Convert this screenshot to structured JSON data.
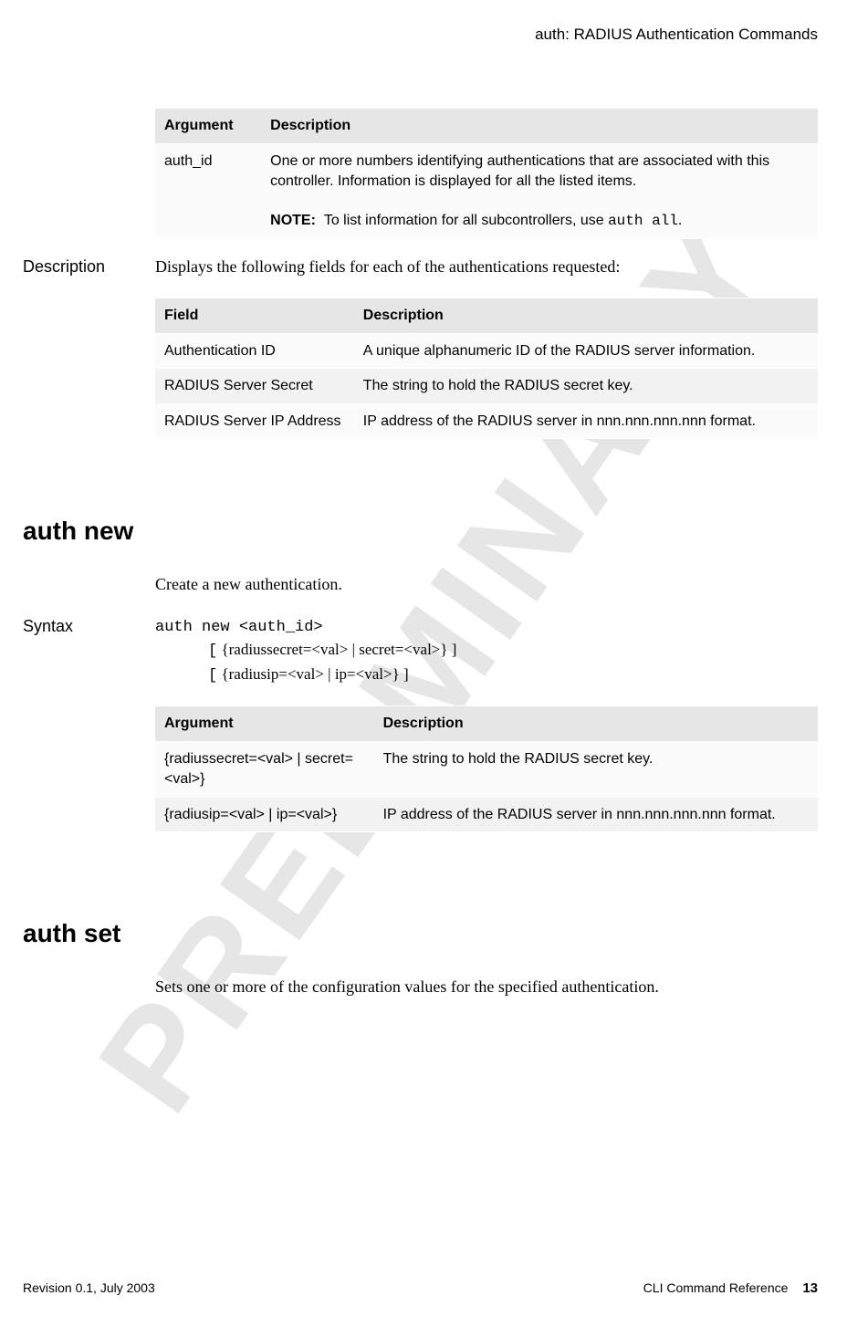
{
  "watermark": "PRELIMINARY",
  "header": {
    "right": "auth: RADIUS Authentication Commands"
  },
  "table1": {
    "head_arg": "Argument",
    "head_desc": "Description",
    "row1_arg": "auth_id",
    "row1_desc_p1": "One or more numbers identifying authentications that are associated with this controller. Information is displayed for all the listed items.",
    "row1_note_label": "NOTE:",
    "row1_note_text": "To list information for all subcontrollers, use ",
    "row1_note_code": "auth all",
    "row1_note_tail": "."
  },
  "description": {
    "label": "Description",
    "text": "Displays the following fields for each of the authentications requested:"
  },
  "table2": {
    "head_field": "Field",
    "head_desc": "Description",
    "r1_f": "Authentication ID",
    "r1_d": "A unique alphanumeric ID of the RADIUS server information.",
    "r2_f": "RADIUS Server Secret",
    "r2_d": "The string to hold the RADIUS secret key.",
    "r3_f": "RADIUS Server IP Address",
    "r3_d": "IP address of the RADIUS server in nnn.nnn.nnn.nnn format."
  },
  "auth_new": {
    "heading": "auth new",
    "intro": "Create a new authentication.",
    "syntax_label": "Syntax",
    "syntax_line1": "auth new <auth_id>",
    "syntax_line2_pre": "[",
    "syntax_line2_body": " {radiussecret=<val> | secret=<val>} ]",
    "syntax_line3_pre": "[",
    "syntax_line3_body": " {radiusip=<val> | ip=<val>} ]"
  },
  "table3": {
    "head_arg": "Argument",
    "head_desc": "Description",
    "r1_a": " {radiussecret=<val> | secret=<val>}",
    "r1_d": " The string to hold the RADIUS secret key.",
    "r2_a": " {radiusip=<val> | ip=<val>}",
    "r2_d": " IP address of the RADIUS server in nnn.nnn.nnn.nnn format."
  },
  "auth_set": {
    "heading": "auth set",
    "intro": "Sets one or more of the configuration values for the specified authentication."
  },
  "footer": {
    "left": "Revision 0.1, July 2003",
    "right_text": "CLI Command Reference",
    "right_num": "13"
  }
}
